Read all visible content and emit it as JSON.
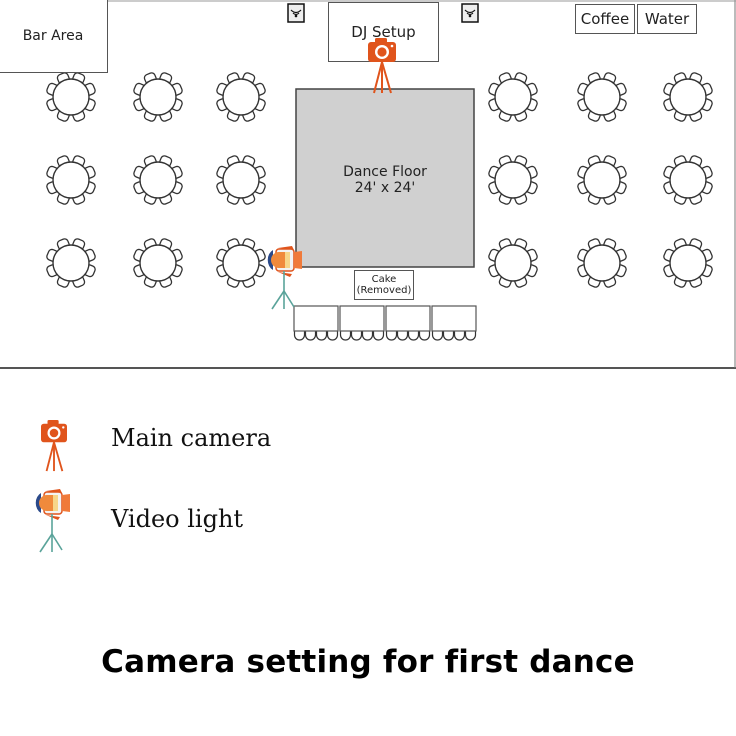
{
  "floor_plan": {
    "areas": {
      "bar_area": "Bar Area",
      "dj_setup": "DJ Setup",
      "coffee": "Coffee",
      "water": "Water",
      "dance_floor_label": "Dance Floor",
      "dance_floor_size": "24' x 24'",
      "cake_line1": "Cake",
      "cake_line2": "(Removed)"
    },
    "round_tables": {
      "count": 18,
      "seats_per_table": 8
    },
    "head_table": {
      "sections": 4,
      "seats_per_section": 4
    },
    "speakers": 2,
    "colors": {
      "dance_floor": "#d0d0d0",
      "camera": "#e0541c",
      "light_stand": "#5aa39a",
      "outline": "#333333"
    }
  },
  "legend": {
    "items": [
      {
        "icon": "camera-on-tripod-icon",
        "label": "Main camera"
      },
      {
        "icon": "video-light-icon",
        "label": "Video light"
      }
    ]
  },
  "title": "Camera setting for first dance"
}
